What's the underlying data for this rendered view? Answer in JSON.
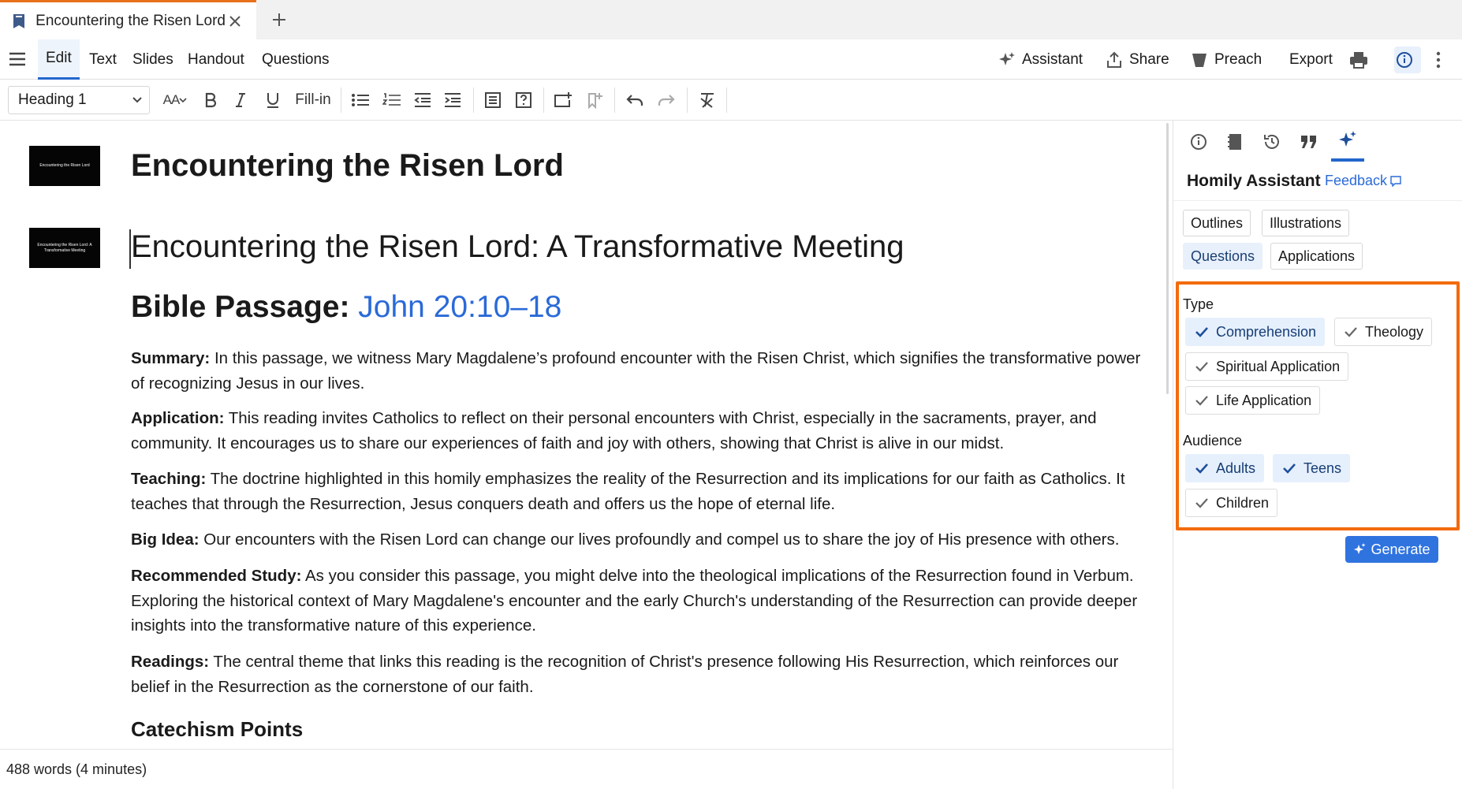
{
  "tab": {
    "title": "Encountering the Risen Lord",
    "new_tab": "+"
  },
  "menu": {
    "items": [
      "Edit",
      "Text",
      "Slides",
      "Handout",
      "Questions"
    ],
    "active": "Edit",
    "right": {
      "assistant": "Assistant",
      "share": "Share",
      "preach": "Preach",
      "export": "Export"
    }
  },
  "toolbar": {
    "style_select": "Heading 1",
    "fill_in": "Fill-in",
    "font_size_label": "AA"
  },
  "editor": {
    "thumbs": [
      "Encountering the Risen Lord",
      "Encountering the Risen Lord: A Transformative Meeting"
    ],
    "title": "Encountering the Risen Lord",
    "subtitle": "Encountering the Risen Lord: A Transformative Meeting",
    "passage_label": "Bible Passage: ",
    "passage_ref": "John 20:10–18",
    "paragraphs": [
      {
        "label": "Summary:",
        "text": " In this passage, we witness Mary Magdalene’s profound encounter with the Risen Christ, which signifies the transformative power of recognizing Jesus in our lives."
      },
      {
        "label": "Application:",
        "text": " This reading invites Catholics to reflect on their personal encounters with Christ, especially in the sacraments, prayer, and community. It encourages us to share our experiences of faith and joy with others, showing that Christ is alive in our midst."
      },
      {
        "label": "Teaching:",
        "text": " The doctrine highlighted in this homily emphasizes the reality of the Resurrection and its implications for our faith as Catholics. It teaches that through the Resurrection, Jesus conquers death and offers us the hope of eternal life."
      },
      {
        "label": "Big Idea:",
        "text": " Our encounters with the Risen Lord can change our lives profoundly and compel us to share the joy of His presence with others."
      },
      {
        "label": "Recommended Study:",
        "text": " As you consider this passage, you might delve into the theological implications of the Resurrection found in Verbum. Exploring the historical context of Mary Magdalene's encounter and the early Church's understanding of the Resurrection can provide deeper insights into the transformative nature of this experience."
      },
      {
        "label": "Readings:",
        "text": " The central theme that links this reading is the recognition of Christ's presence following His Resurrection, which reinforces our belief in the Resurrection as the cornerstone of our faith."
      }
    ],
    "section_heading": "Catechism Points"
  },
  "status": {
    "word_count": "488 words (4 minutes)"
  },
  "panel": {
    "title": "Homily Assistant",
    "feedback": "Feedback",
    "categories": [
      {
        "label": "Outlines",
        "selected": false
      },
      {
        "label": "Illustrations",
        "selected": false
      },
      {
        "label": "Questions",
        "selected": true
      },
      {
        "label": "Applications",
        "selected": false
      }
    ],
    "type_label": "Type",
    "types": [
      {
        "label": "Comprehension",
        "on": true
      },
      {
        "label": "Theology",
        "on": false
      },
      {
        "label": "Spiritual Application",
        "on": false
      },
      {
        "label": "Life Application",
        "on": false
      }
    ],
    "audience_label": "Audience",
    "audiences": [
      {
        "label": "Adults",
        "on": true
      },
      {
        "label": "Teens",
        "on": true
      },
      {
        "label": "Children",
        "on": false
      }
    ],
    "generate": "Generate"
  },
  "colors": {
    "accent": "#2266cc",
    "highlight": "#f26b0c",
    "link": "#2a6ad8",
    "tab_indicator": "#e8711c"
  }
}
